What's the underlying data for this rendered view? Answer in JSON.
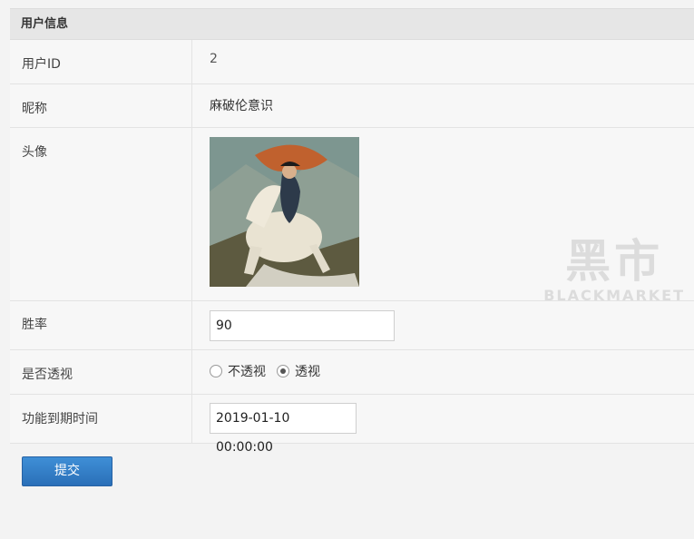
{
  "panel": {
    "title": "用户信息"
  },
  "fields": {
    "user_id": {
      "label": "用户ID",
      "value": "2"
    },
    "nickname": {
      "label": "昵称",
      "value": "麻破伦意识"
    },
    "avatar": {
      "label": "头像"
    },
    "win_rate": {
      "label": "胜率",
      "value": "90"
    },
    "see_through": {
      "label": "是否透视",
      "options": [
        "不透视",
        "透视"
      ],
      "selected": "透视"
    },
    "expire_time": {
      "label": "功能到期时间",
      "value": "2019-01-10 00:00:00"
    }
  },
  "submit_label": "提交",
  "watermark": {
    "big": "黑市",
    "small": "BLACKMARKET"
  }
}
